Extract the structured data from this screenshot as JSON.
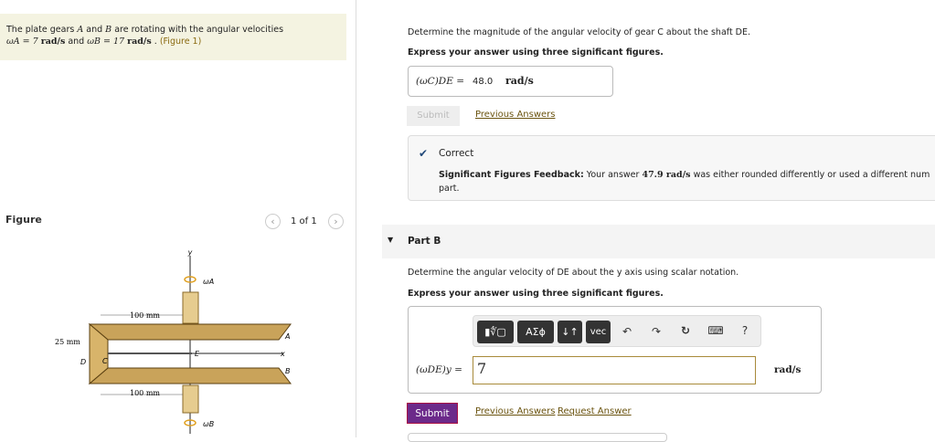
{
  "problem": {
    "text1": "The plate gears",
    "A": "A",
    "and": "and",
    "B": "B",
    "text2": "are rotating with the angular velocities",
    "wA": "ωA = 7",
    "rad": "rad/s",
    "and2": "and",
    "wB": "ωB = 17",
    "rad2": "rad/s",
    "dot": ".",
    "figure_link": "(Figure 1)"
  },
  "figure": {
    "title": "Figure",
    "pager": "1 of 1",
    "prev": "‹",
    "next": "›",
    "labels": {
      "y": "y",
      "wA": "ωA",
      "wB": "ωB",
      "dim_top": "100 mm",
      "dim_bot": "100 mm",
      "dim_left": "25 mm",
      "A": "A",
      "B": "B",
      "D": "D",
      "C": "C",
      "E": "E",
      "x": "x"
    }
  },
  "partA": {
    "question": "Determine the magnitude of the angular velocity of gear C about the shaft DE.",
    "instruction": "Express your answer using three significant figures.",
    "var_label": "(ωC)DE =",
    "value": "48.0",
    "unit": "rad/s",
    "submit": "Submit",
    "previous": "Previous Answers"
  },
  "feedback": {
    "status": "Correct",
    "sf_label": "Significant Figures Feedback:",
    "msg1": "Your answer",
    "answer": "47.9 rad/s",
    "msg2": "was either rounded differently or used a different num",
    "msg3": "part."
  },
  "partB": {
    "title": "Part B",
    "question": "Determine the angular velocity of DE about the y axis using scalar notation.",
    "instruction": "Express your answer using three significant figures.",
    "toolbar": {
      "templates": "▮∜▢",
      "greek": "ΑΣϕ",
      "arrows": "↓↑",
      "vec": "vec",
      "undo": "↶",
      "redo": "↷",
      "reset": "↻",
      "keyboard": "⌨",
      "help": "?"
    },
    "var_label": "(ωDE)y =",
    "value": "7",
    "unit": "rad/s",
    "submit": "Submit",
    "previous": "Previous Answers",
    "request": "Request Answer"
  }
}
